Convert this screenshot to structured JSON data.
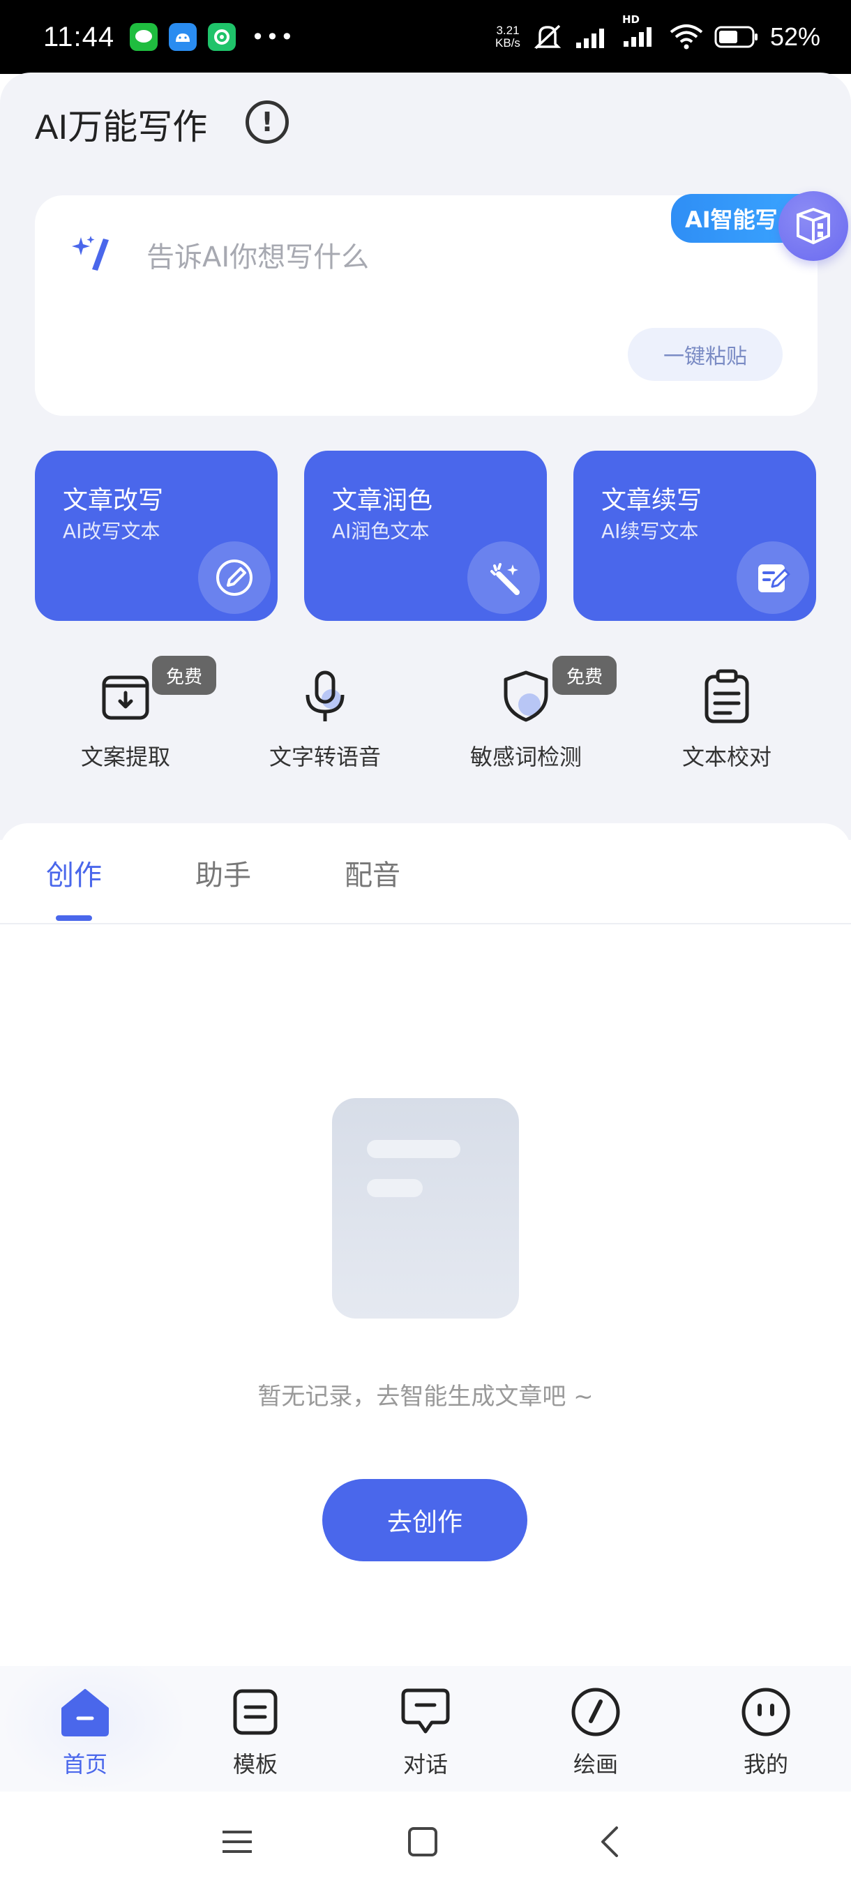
{
  "status_bar": {
    "time": "11:44",
    "net_speed_value": "3.21",
    "net_speed_unit": "KB/s",
    "network_label": "HD",
    "battery": "52%"
  },
  "header": {
    "title": "AI万能写作"
  },
  "prompt": {
    "placeholder": "告诉AI你想写什么",
    "paste_label": "一键粘贴",
    "badge_label": "AI智能写"
  },
  "features": [
    {
      "title": "文章改写",
      "subtitle": "AI改写文本",
      "icon": "pencil-edit-icon"
    },
    {
      "title": "文章润色",
      "subtitle": "AI润色文本",
      "icon": "magic-wand-icon"
    },
    {
      "title": "文章续写",
      "subtitle": "AI续写文本",
      "icon": "note-edit-icon"
    }
  ],
  "tools": [
    {
      "label": "文案提取",
      "icon": "download-box-icon",
      "tag": "免费"
    },
    {
      "label": "文字转语音",
      "icon": "microphone-icon",
      "tag": ""
    },
    {
      "label": "敏感词检测",
      "icon": "shield-icon",
      "tag": "免费"
    },
    {
      "label": "文本校对",
      "icon": "clipboard-icon",
      "tag": ""
    }
  ],
  "tabs": [
    {
      "label": "创作",
      "active": true
    },
    {
      "label": "助手",
      "active": false
    },
    {
      "label": "配音",
      "active": false
    }
  ],
  "empty_state": {
    "message": "暂无记录，去智能生成文章吧 ~",
    "button_label": "去创作"
  },
  "bottom_nav": [
    {
      "label": "首页",
      "icon": "home-icon",
      "active": true
    },
    {
      "label": "模板",
      "icon": "template-icon",
      "active": false
    },
    {
      "label": "对话",
      "icon": "chat-icon",
      "active": false
    },
    {
      "label": "绘画",
      "icon": "paint-icon",
      "active": false
    },
    {
      "label": "我的",
      "icon": "profile-icon",
      "active": false
    }
  ],
  "colors": {
    "accent": "#4a67eb",
    "background": "#f2f3f8",
    "badge": "#2f8ef5"
  }
}
